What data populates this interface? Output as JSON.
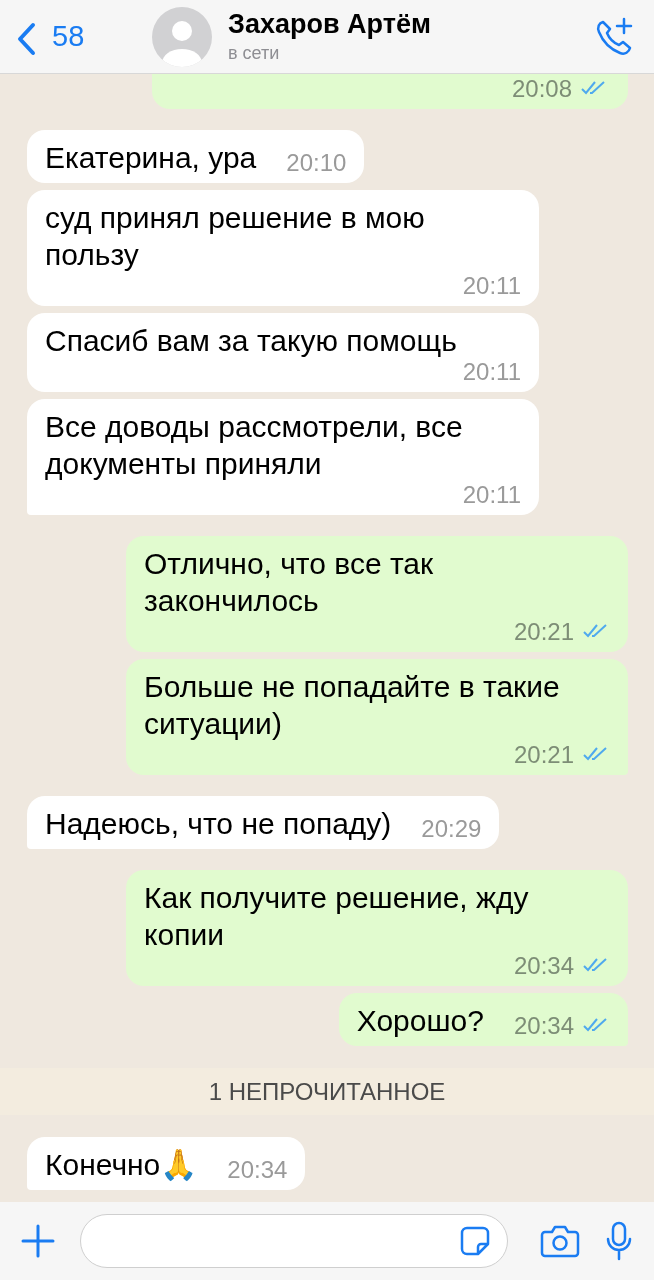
{
  "header": {
    "back_count": "58",
    "contact_name": "Захаров Артём",
    "status": "в сети"
  },
  "messages": [
    {
      "kind": "out",
      "time": "20:08",
      "read": true,
      "tail": false,
      "partial": true
    },
    {
      "kind": "in",
      "text": "Екатерина, ура",
      "time": "20:10",
      "tail": false
    },
    {
      "kind": "in",
      "text": "суд принял решение в мою пользу",
      "time": "20:11",
      "tail": false
    },
    {
      "kind": "in",
      "text": "Спасиб вам за такую помощь",
      "time": "20:11",
      "tail": false
    },
    {
      "kind": "in",
      "text": "Все доводы рассмотрели, все документы приняли",
      "time": "20:11",
      "tail": true
    },
    {
      "kind": "out",
      "text": "Отлично, что все так закончилось",
      "time": "20:21",
      "read": true,
      "tail": false
    },
    {
      "kind": "out",
      "text": "Больше не попадайте в такие ситуации)",
      "time": "20:21",
      "read": true,
      "tail": true
    },
    {
      "kind": "in",
      "text": "Надеюсь, что не попаду)",
      "time": "20:29",
      "tail": true
    },
    {
      "kind": "out",
      "text": "Как получите решение, жду копии",
      "time": "20:34",
      "read": true,
      "tail": false
    },
    {
      "kind": "out",
      "text": "Хорошо?",
      "time": "20:34",
      "read": true,
      "tail": true
    },
    {
      "kind": "divider",
      "text": "1 НЕПРОЧИТАННОЕ"
    },
    {
      "kind": "in",
      "text": "Конечно🙏",
      "time": "20:34",
      "tail": true
    }
  ]
}
